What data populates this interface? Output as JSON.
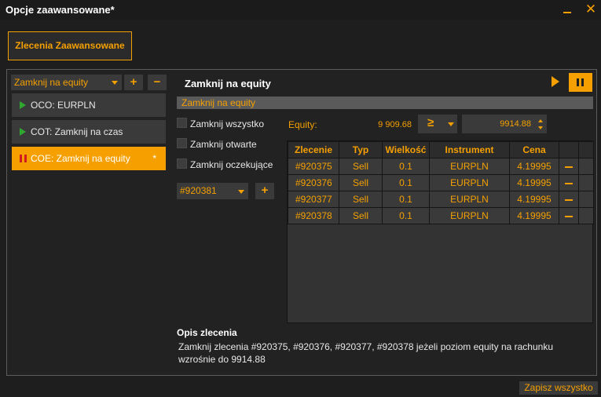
{
  "window": {
    "title": "Opcje zaawansowane*",
    "minimize_icon": "minimize-icon",
    "close_glyph": "✕"
  },
  "tabs": [
    {
      "label": "Zlecenia Zaawansowane",
      "active": true
    }
  ],
  "strategy_selector": {
    "value": "Zamknij na equity",
    "add_glyph": "+",
    "remove_glyph": "−"
  },
  "strategies": [
    {
      "label": "OCO: EURPLN",
      "status_icon": "play-icon",
      "active": false,
      "modified": ""
    },
    {
      "label": "COT: Zamknij na czas",
      "status_icon": "play-icon",
      "active": false,
      "modified": ""
    },
    {
      "label": "COE: Zamknij na equity",
      "status_icon": "pause-icon",
      "active": true,
      "modified": "*"
    }
  ],
  "detail": {
    "title": "Zamknij na equity",
    "name_field": "Zamknij na equity",
    "checkboxes": [
      {
        "label": "Zamknij wszystko",
        "checked": false
      },
      {
        "label": "Zamknij otwarte",
        "checked": false
      },
      {
        "label": "Zamknij oczekujące",
        "checked": false
      }
    ],
    "order_selector": {
      "value": "#920381",
      "add_glyph": "+"
    },
    "equity": {
      "label": "Equity:",
      "value": "9 909.68",
      "condition_symbol": "≥",
      "threshold": "9914.88"
    }
  },
  "orders_table": {
    "columns": [
      "Zlecenie",
      "Typ",
      "Wielkość",
      "Instrument",
      "Cena",
      ""
    ],
    "rows": [
      {
        "order": "#920375",
        "type": "Sell",
        "size": "0.1",
        "instrument": "EURPLN",
        "price": "4.19995"
      },
      {
        "order": "#920376",
        "type": "Sell",
        "size": "0.1",
        "instrument": "EURPLN",
        "price": "4.19995"
      },
      {
        "order": "#920377",
        "type": "Sell",
        "size": "0.1",
        "instrument": "EURPLN",
        "price": "4.19995"
      },
      {
        "order": "#920378",
        "type": "Sell",
        "size": "0.1",
        "instrument": "EURPLN",
        "price": "4.19995"
      }
    ]
  },
  "description": {
    "title": "Opis zlecenia",
    "text": "Zamknij zlecenia #920375, #920376, #920377, #920378  jeżeli poziom equity na rachunku wzrośnie do 9914.88"
  },
  "footer": {
    "save_all_label": "Zapisz wszystko"
  },
  "colors": {
    "accent": "#f5a000",
    "play_green": "#2ea82e",
    "pause_red": "#d21b1b",
    "background": "#1e1e1e"
  }
}
